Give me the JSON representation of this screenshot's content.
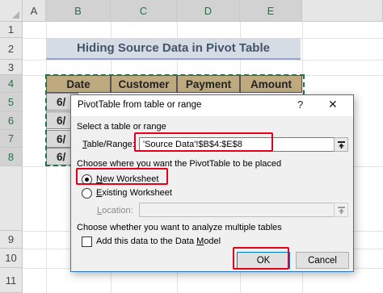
{
  "spreadsheet": {
    "columns": [
      "A",
      "B",
      "C",
      "D",
      "E"
    ],
    "rows": [
      "1",
      "2",
      "3",
      "4",
      "5",
      "6",
      "7",
      "8",
      "9",
      "10",
      "11"
    ],
    "title": "Hiding Source Data in Pivot Table",
    "table_headers": [
      "Date",
      "Customer",
      "Payment",
      "Amount"
    ],
    "date_fragments": [
      "6/",
      "6/",
      "6/",
      "6/"
    ]
  },
  "dialog": {
    "title": "PivotTable from table or range",
    "help": "?",
    "close": "✕",
    "section_select": "Select a table or range",
    "table_range_label_pre": "T",
    "table_range_label_mid": "able/Range:",
    "table_range_value": "'Source Data'!$B$4:$E$8",
    "section_place": "Choose where you want the PivotTable to be placed",
    "new_ws_u": "N",
    "new_ws_rest": "ew Worksheet",
    "existing_ws_u": "E",
    "existing_ws_rest": "xisting Worksheet",
    "location_u": "L",
    "location_rest": "ocation:",
    "location_value": "",
    "section_multi": "Choose whether you want to analyze multiple tables",
    "data_model_pre": "Add this data to the Data ",
    "data_model_u": "M",
    "data_model_post": "odel",
    "ok": "OK",
    "cancel": "Cancel"
  },
  "colors": {
    "highlight_red": "#e3001b",
    "excel_green": "#217346",
    "header_fill": "#bfa97f",
    "title_fill": "#d6dce4",
    "accent_blue": "#0078d7"
  },
  "icons": [
    "collapse-dialog-icon",
    "help-icon",
    "close-icon"
  ]
}
